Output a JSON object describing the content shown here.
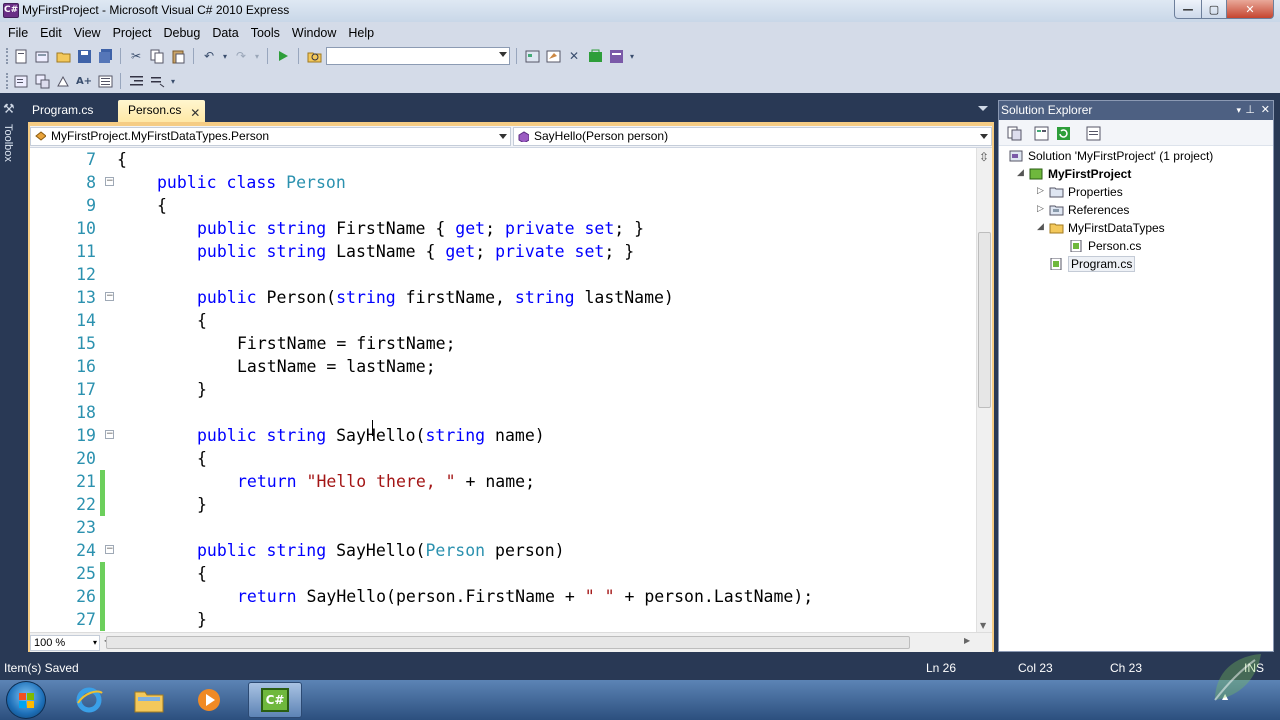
{
  "window": {
    "title": "MyFirstProject - Microsoft Visual C# 2010 Express",
    "app_icon": "C#",
    "minimize": "—",
    "maximize": "▢",
    "close": "✕"
  },
  "menu": [
    "File",
    "Edit",
    "View",
    "Project",
    "Debug",
    "Data",
    "Tools",
    "Window",
    "Help"
  ],
  "toolbox_label": "Toolbox",
  "tabs": [
    {
      "label": "Program.cs",
      "active": false
    },
    {
      "label": "Person.cs",
      "active": true,
      "close": "✕"
    }
  ],
  "nav": {
    "type_combo": "MyFirstProject.MyFirstDataTypes.Person",
    "member_combo": "SayHello(Person person)"
  },
  "code_lines": [
    {
      "n": "7",
      "fold": "",
      "changed": false,
      "indent": 0,
      "tokens": [
        {
          "t": "{",
          "c": "p"
        }
      ]
    },
    {
      "n": "8",
      "fold": "−",
      "changed": false,
      "indent": 1,
      "tokens": [
        {
          "t": "public",
          "c": "kw"
        },
        {
          "t": " "
        },
        {
          "t": "class",
          "c": "kw"
        },
        {
          "t": " "
        },
        {
          "t": "Person",
          "c": "ty"
        }
      ]
    },
    {
      "n": "9",
      "fold": "",
      "changed": false,
      "indent": 1,
      "tokens": [
        {
          "t": "{"
        }
      ]
    },
    {
      "n": "10",
      "fold": "",
      "changed": false,
      "indent": 2,
      "tokens": [
        {
          "t": "public",
          "c": "kw"
        },
        {
          "t": " "
        },
        {
          "t": "string",
          "c": "kw"
        },
        {
          "t": " FirstName { "
        },
        {
          "t": "get",
          "c": "kw"
        },
        {
          "t": "; "
        },
        {
          "t": "private",
          "c": "kw"
        },
        {
          "t": " "
        },
        {
          "t": "set",
          "c": "kw"
        },
        {
          "t": "; }"
        }
      ]
    },
    {
      "n": "11",
      "fold": "",
      "changed": false,
      "indent": 2,
      "tokens": [
        {
          "t": "public",
          "c": "kw"
        },
        {
          "t": " "
        },
        {
          "t": "string",
          "c": "kw"
        },
        {
          "t": " LastName { "
        },
        {
          "t": "get",
          "c": "kw"
        },
        {
          "t": "; "
        },
        {
          "t": "private",
          "c": "kw"
        },
        {
          "t": " "
        },
        {
          "t": "set",
          "c": "kw"
        },
        {
          "t": "; }"
        }
      ]
    },
    {
      "n": "12",
      "fold": "",
      "changed": false,
      "indent": 0,
      "tokens": []
    },
    {
      "n": "13",
      "fold": "−",
      "changed": false,
      "indent": 2,
      "tokens": [
        {
          "t": "public",
          "c": "kw"
        },
        {
          "t": " Person("
        },
        {
          "t": "string",
          "c": "kw"
        },
        {
          "t": " firstName, "
        },
        {
          "t": "string",
          "c": "kw"
        },
        {
          "t": " lastName)"
        }
      ]
    },
    {
      "n": "14",
      "fold": "",
      "changed": false,
      "indent": 2,
      "tokens": [
        {
          "t": "{"
        }
      ]
    },
    {
      "n": "15",
      "fold": "",
      "changed": false,
      "indent": 3,
      "tokens": [
        {
          "t": "FirstName = firstName;"
        }
      ]
    },
    {
      "n": "16",
      "fold": "",
      "changed": false,
      "indent": 3,
      "tokens": [
        {
          "t": "LastName = lastName;"
        }
      ]
    },
    {
      "n": "17",
      "fold": "",
      "changed": false,
      "indent": 2,
      "tokens": [
        {
          "t": "}"
        }
      ]
    },
    {
      "n": "18",
      "fold": "",
      "changed": false,
      "indent": 0,
      "tokens": []
    },
    {
      "n": "19",
      "fold": "−",
      "changed": false,
      "indent": 2,
      "tokens": [
        {
          "t": "public",
          "c": "kw"
        },
        {
          "t": " "
        },
        {
          "t": "string",
          "c": "kw"
        },
        {
          "t": " SayHello("
        },
        {
          "t": "string",
          "c": "kw"
        },
        {
          "t": " name)"
        }
      ]
    },
    {
      "n": "20",
      "fold": "",
      "changed": false,
      "indent": 2,
      "tokens": [
        {
          "t": "{"
        }
      ]
    },
    {
      "n": "21",
      "fold": "",
      "changed": true,
      "indent": 3,
      "tokens": [
        {
          "t": "return",
          "c": "kw"
        },
        {
          "t": " "
        },
        {
          "t": "\"Hello there, \"",
          "c": "st"
        },
        {
          "t": " + name;"
        }
      ]
    },
    {
      "n": "22",
      "fold": "",
      "changed": true,
      "indent": 2,
      "tokens": [
        {
          "t": "}"
        }
      ]
    },
    {
      "n": "23",
      "fold": "",
      "changed": false,
      "indent": 0,
      "tokens": []
    },
    {
      "n": "24",
      "fold": "−",
      "changed": false,
      "indent": 2,
      "tokens": [
        {
          "t": "public",
          "c": "kw"
        },
        {
          "t": " "
        },
        {
          "t": "string",
          "c": "kw"
        },
        {
          "t": " SayHello("
        },
        {
          "t": "Person",
          "c": "ty"
        },
        {
          "t": " person)"
        }
      ]
    },
    {
      "n": "25",
      "fold": "",
      "changed": true,
      "indent": 2,
      "tokens": [
        {
          "t": "{"
        }
      ]
    },
    {
      "n": "26",
      "fold": "",
      "changed": true,
      "indent": 3,
      "tokens": [
        {
          "t": "return",
          "c": "kw"
        },
        {
          "t": " SayHello(person.FirstName + "
        },
        {
          "t": "\" \"",
          "c": "st"
        },
        {
          "t": " + person.LastName);"
        }
      ]
    },
    {
      "n": "27",
      "fold": "",
      "changed": true,
      "indent": 2,
      "tokens": [
        {
          "t": "}"
        }
      ]
    }
  ],
  "zoom": "100 %",
  "solution_explorer": {
    "title": "Solution Explorer",
    "nodes": [
      {
        "label": "Solution 'MyFirstProject' (1 project)",
        "icon": "solution-icon",
        "expander": "",
        "bold": false,
        "selected": false
      },
      {
        "label": "MyFirstProject",
        "icon": "csharp-project-icon",
        "expander": "◢",
        "bold": true,
        "selected": false
      },
      {
        "label": "Properties",
        "icon": "properties-folder-icon",
        "expander": "▷",
        "bold": false,
        "selected": false
      },
      {
        "label": "References",
        "icon": "references-folder-icon",
        "expander": "▷",
        "bold": false,
        "selected": false
      },
      {
        "label": "MyFirstDataTypes",
        "icon": "folder-icon",
        "expander": "◢",
        "bold": false,
        "selected": false
      },
      {
        "label": "Person.cs",
        "icon": "csharp-file-icon",
        "expander": "",
        "bold": false,
        "selected": false
      },
      {
        "label": "Program.cs",
        "icon": "csharp-file-icon",
        "expander": "",
        "bold": false,
        "selected": true
      }
    ]
  },
  "status": {
    "message": "Item(s) Saved",
    "ln": "Ln 26",
    "col": "Col 23",
    "ch": "Ch 23",
    "mode": "INS"
  },
  "taskbar": {
    "active_app": "C#"
  },
  "colors": {
    "keyword": "#0000ff",
    "type": "#2b91af",
    "string": "#a31515",
    "line_number": "#2b91af",
    "change_bar": "#6ccf5c",
    "chrome": "#293955",
    "tab_active": "#ffe8a6"
  }
}
